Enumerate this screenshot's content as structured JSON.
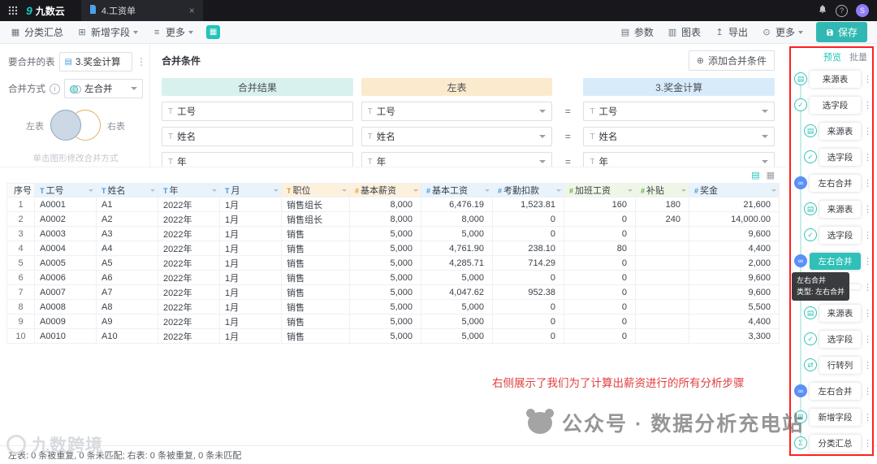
{
  "topbar": {
    "logo_mark": "9",
    "logo_text": "九数云",
    "tab_label": "4.工资单",
    "avatar": "S"
  },
  "toolbar": {
    "left": [
      {
        "label": "分类汇总"
      },
      {
        "label": "新增字段"
      },
      {
        "label": "更多"
      }
    ],
    "right": [
      {
        "label": "参数"
      },
      {
        "label": "图表"
      },
      {
        "label": "导出"
      },
      {
        "label": "更多"
      }
    ],
    "save_label": "保存"
  },
  "left_panel": {
    "table_label": "要合并的表",
    "table_value": "3.奖金计算",
    "mode_label": "合并方式",
    "mode_value": "左合并",
    "venn_left": "左表",
    "venn_right": "右表",
    "hint": "单击图形修改合并方式"
  },
  "conditions": {
    "title": "合并条件",
    "add_label": "添加合并条件",
    "col_result": "合并结果",
    "col_left": "左表",
    "col_right": "3.奖金计算",
    "equals": "=",
    "type_glyph": "T",
    "rows": [
      {
        "result": "工号",
        "left": "工号",
        "right": "工号"
      },
      {
        "result": "姓名",
        "left": "姓名",
        "right": "姓名"
      },
      {
        "result": "年",
        "left": "年",
        "right": "年"
      }
    ]
  },
  "table": {
    "headers": [
      {
        "label": "序号",
        "type": "",
        "color": "plain"
      },
      {
        "label": "工号",
        "type": "T",
        "color": "blue"
      },
      {
        "label": "姓名",
        "type": "T",
        "color": "blue"
      },
      {
        "label": "年",
        "type": "T",
        "color": "blue"
      },
      {
        "label": "月",
        "type": "T",
        "color": "blue"
      },
      {
        "label": "职位",
        "type": "T",
        "color": "orange"
      },
      {
        "label": "基本薪资",
        "type": "#",
        "color": "orange"
      },
      {
        "label": "基本工资",
        "type": "#",
        "color": "blue"
      },
      {
        "label": "考勤扣款",
        "type": "#",
        "color": "blue"
      },
      {
        "label": "加班工资",
        "type": "#",
        "color": "green"
      },
      {
        "label": "补贴",
        "type": "#",
        "color": "green"
      },
      {
        "label": "奖金",
        "type": "#",
        "color": "blue"
      }
    ],
    "rows": [
      [
        "1",
        "A0001",
        "A1",
        "2022年",
        "1月",
        "销售组长",
        "8,000",
        "6,476.19",
        "1,523.81",
        "160",
        "180",
        "21,600"
      ],
      [
        "2",
        "A0002",
        "A2",
        "2022年",
        "1月",
        "销售组长",
        "8,000",
        "8,000",
        "0",
        "0",
        "240",
        "14,000.00"
      ],
      [
        "3",
        "A0003",
        "A3",
        "2022年",
        "1月",
        "销售",
        "5,000",
        "5,000",
        "0",
        "0",
        "",
        "9,600"
      ],
      [
        "4",
        "A0004",
        "A4",
        "2022年",
        "1月",
        "销售",
        "5,000",
        "4,761.90",
        "238.10",
        "80",
        "",
        "4,400"
      ],
      [
        "5",
        "A0005",
        "A5",
        "2022年",
        "1月",
        "销售",
        "5,000",
        "4,285.71",
        "714.29",
        "0",
        "",
        "2,000"
      ],
      [
        "6",
        "A0006",
        "A6",
        "2022年",
        "1月",
        "销售",
        "5,000",
        "5,000",
        "0",
        "0",
        "",
        "9,600"
      ],
      [
        "7",
        "A0007",
        "A7",
        "2022年",
        "1月",
        "销售",
        "5,000",
        "4,047.62",
        "952.38",
        "0",
        "",
        "9,600"
      ],
      [
        "8",
        "A0008",
        "A8",
        "2022年",
        "1月",
        "销售",
        "5,000",
        "5,000",
        "0",
        "0",
        "",
        "5,500"
      ],
      [
        "9",
        "A0009",
        "A9",
        "2022年",
        "1月",
        "销售",
        "5,000",
        "5,000",
        "0",
        "0",
        "",
        "4,400"
      ],
      [
        "10",
        "A0010",
        "A10",
        "2022年",
        "1月",
        "销售",
        "5,000",
        "5,000",
        "0",
        "0",
        "",
        "3,300"
      ]
    ]
  },
  "steps": {
    "tab_preview": "预览",
    "tab_batch": "批量",
    "items": [
      {
        "label": "来源表",
        "icon": "source-table",
        "indent": 0
      },
      {
        "label": "选字段",
        "icon": "select-fields",
        "indent": 0
      },
      {
        "label": "来源表",
        "icon": "source-table",
        "indent": 1
      },
      {
        "label": "选字段",
        "icon": "select-fields",
        "indent": 1
      },
      {
        "label": "左右合并",
        "icon": "merge",
        "indent": 0
      },
      {
        "label": "来源表",
        "icon": "source-table",
        "indent": 1
      },
      {
        "label": "选字段",
        "icon": "select-fields",
        "indent": 1
      },
      {
        "label": "左右合并",
        "icon": "merge",
        "indent": 0,
        "selected": true
      },
      {
        "label": "",
        "icon": "select-fields",
        "indent": 0
      },
      {
        "label": "来源表",
        "icon": "source-table",
        "indent": 1
      },
      {
        "label": "选字段",
        "icon": "select-fields",
        "indent": 1
      },
      {
        "label": "行转列",
        "icon": "pivot",
        "indent": 1
      },
      {
        "label": "左右合并",
        "icon": "merge",
        "indent": 0
      },
      {
        "label": "新增字段",
        "icon": "add-field",
        "indent": 0
      },
      {
        "label": "分类汇总",
        "icon": "summary",
        "indent": 0
      }
    ],
    "tooltip_line1": "左右合并",
    "tooltip_line2": "类型: 左右合并"
  },
  "annotation": "右侧展示了我们为了计算出薪资进行的所有分析步骤",
  "statusbar": "左表: 0 条被重复, 0 条未匹配; 右表: 0 条被重复, 0 条未匹配",
  "watermarks": {
    "center": "公众号 · 数据分析充电站",
    "corner": "九数跨境"
  },
  "icons": {
    "source-table": "▤",
    "select-fields": "✓",
    "merge": "∞",
    "pivot": "⇄",
    "summary": "Σ",
    "add-field": "⊞",
    "kebab": "⋮"
  },
  "colors": {
    "accent_teal": "#23c3ba",
    "merge_blue": "#5b8ff9",
    "annotation_red": "#e03e3e",
    "frame_red": "#ff1f1f",
    "header_blue": "#e8f3fc",
    "header_orange": "#fdf1dd",
    "header_green": "#eef7e6"
  }
}
